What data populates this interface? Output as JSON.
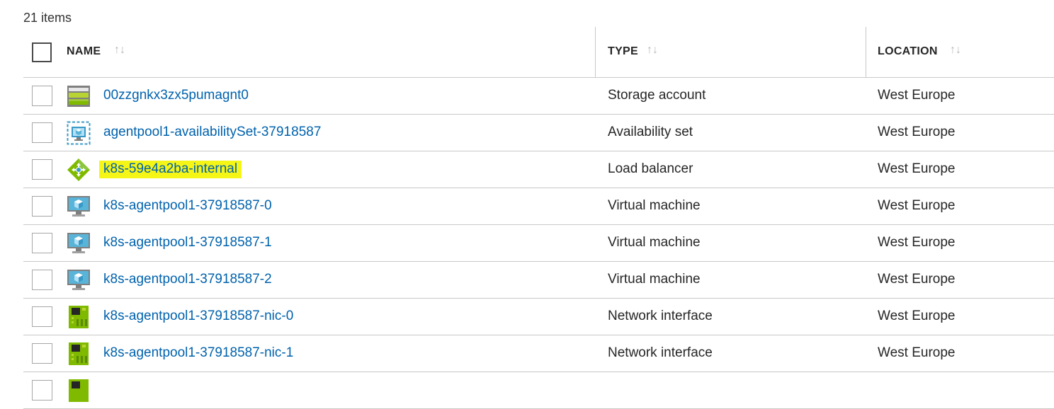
{
  "item_count": "21 items",
  "columns": {
    "name": "NAME",
    "type": "TYPE",
    "location": "LOCATION",
    "sort_glyph": "↑↓"
  },
  "rows": [
    {
      "name": "00zzgnkx3zx5pumagnt0",
      "type": "Storage account",
      "location": "West Europe",
      "icon": "storage-account-icon",
      "highlighted": false
    },
    {
      "name": "agentpool1-availabilitySet-37918587",
      "type": "Availability set",
      "location": "West Europe",
      "icon": "availability-set-icon",
      "highlighted": false
    },
    {
      "name": "k8s-59e4a2ba-internal",
      "type": "Load balancer",
      "location": "West Europe",
      "icon": "load-balancer-icon",
      "highlighted": true
    },
    {
      "name": "k8s-agentpool1-37918587-0",
      "type": "Virtual machine",
      "location": "West Europe",
      "icon": "virtual-machine-icon",
      "highlighted": false
    },
    {
      "name": "k8s-agentpool1-37918587-1",
      "type": "Virtual machine",
      "location": "West Europe",
      "icon": "virtual-machine-icon",
      "highlighted": false
    },
    {
      "name": "k8s-agentpool1-37918587-2",
      "type": "Virtual machine",
      "location": "West Europe",
      "icon": "virtual-machine-icon",
      "highlighted": false
    },
    {
      "name": "k8s-agentpool1-37918587-nic-0",
      "type": "Network interface",
      "location": "West Europe",
      "icon": "network-interface-icon",
      "highlighted": false
    },
    {
      "name": "k8s-agentpool1-37918587-nic-1",
      "type": "Network interface",
      "location": "West Europe",
      "icon": "network-interface-icon",
      "highlighted": false
    }
  ],
  "colors": {
    "link": "#0062ad",
    "highlight": "#f5f516",
    "divider": "#c8c8c8"
  }
}
